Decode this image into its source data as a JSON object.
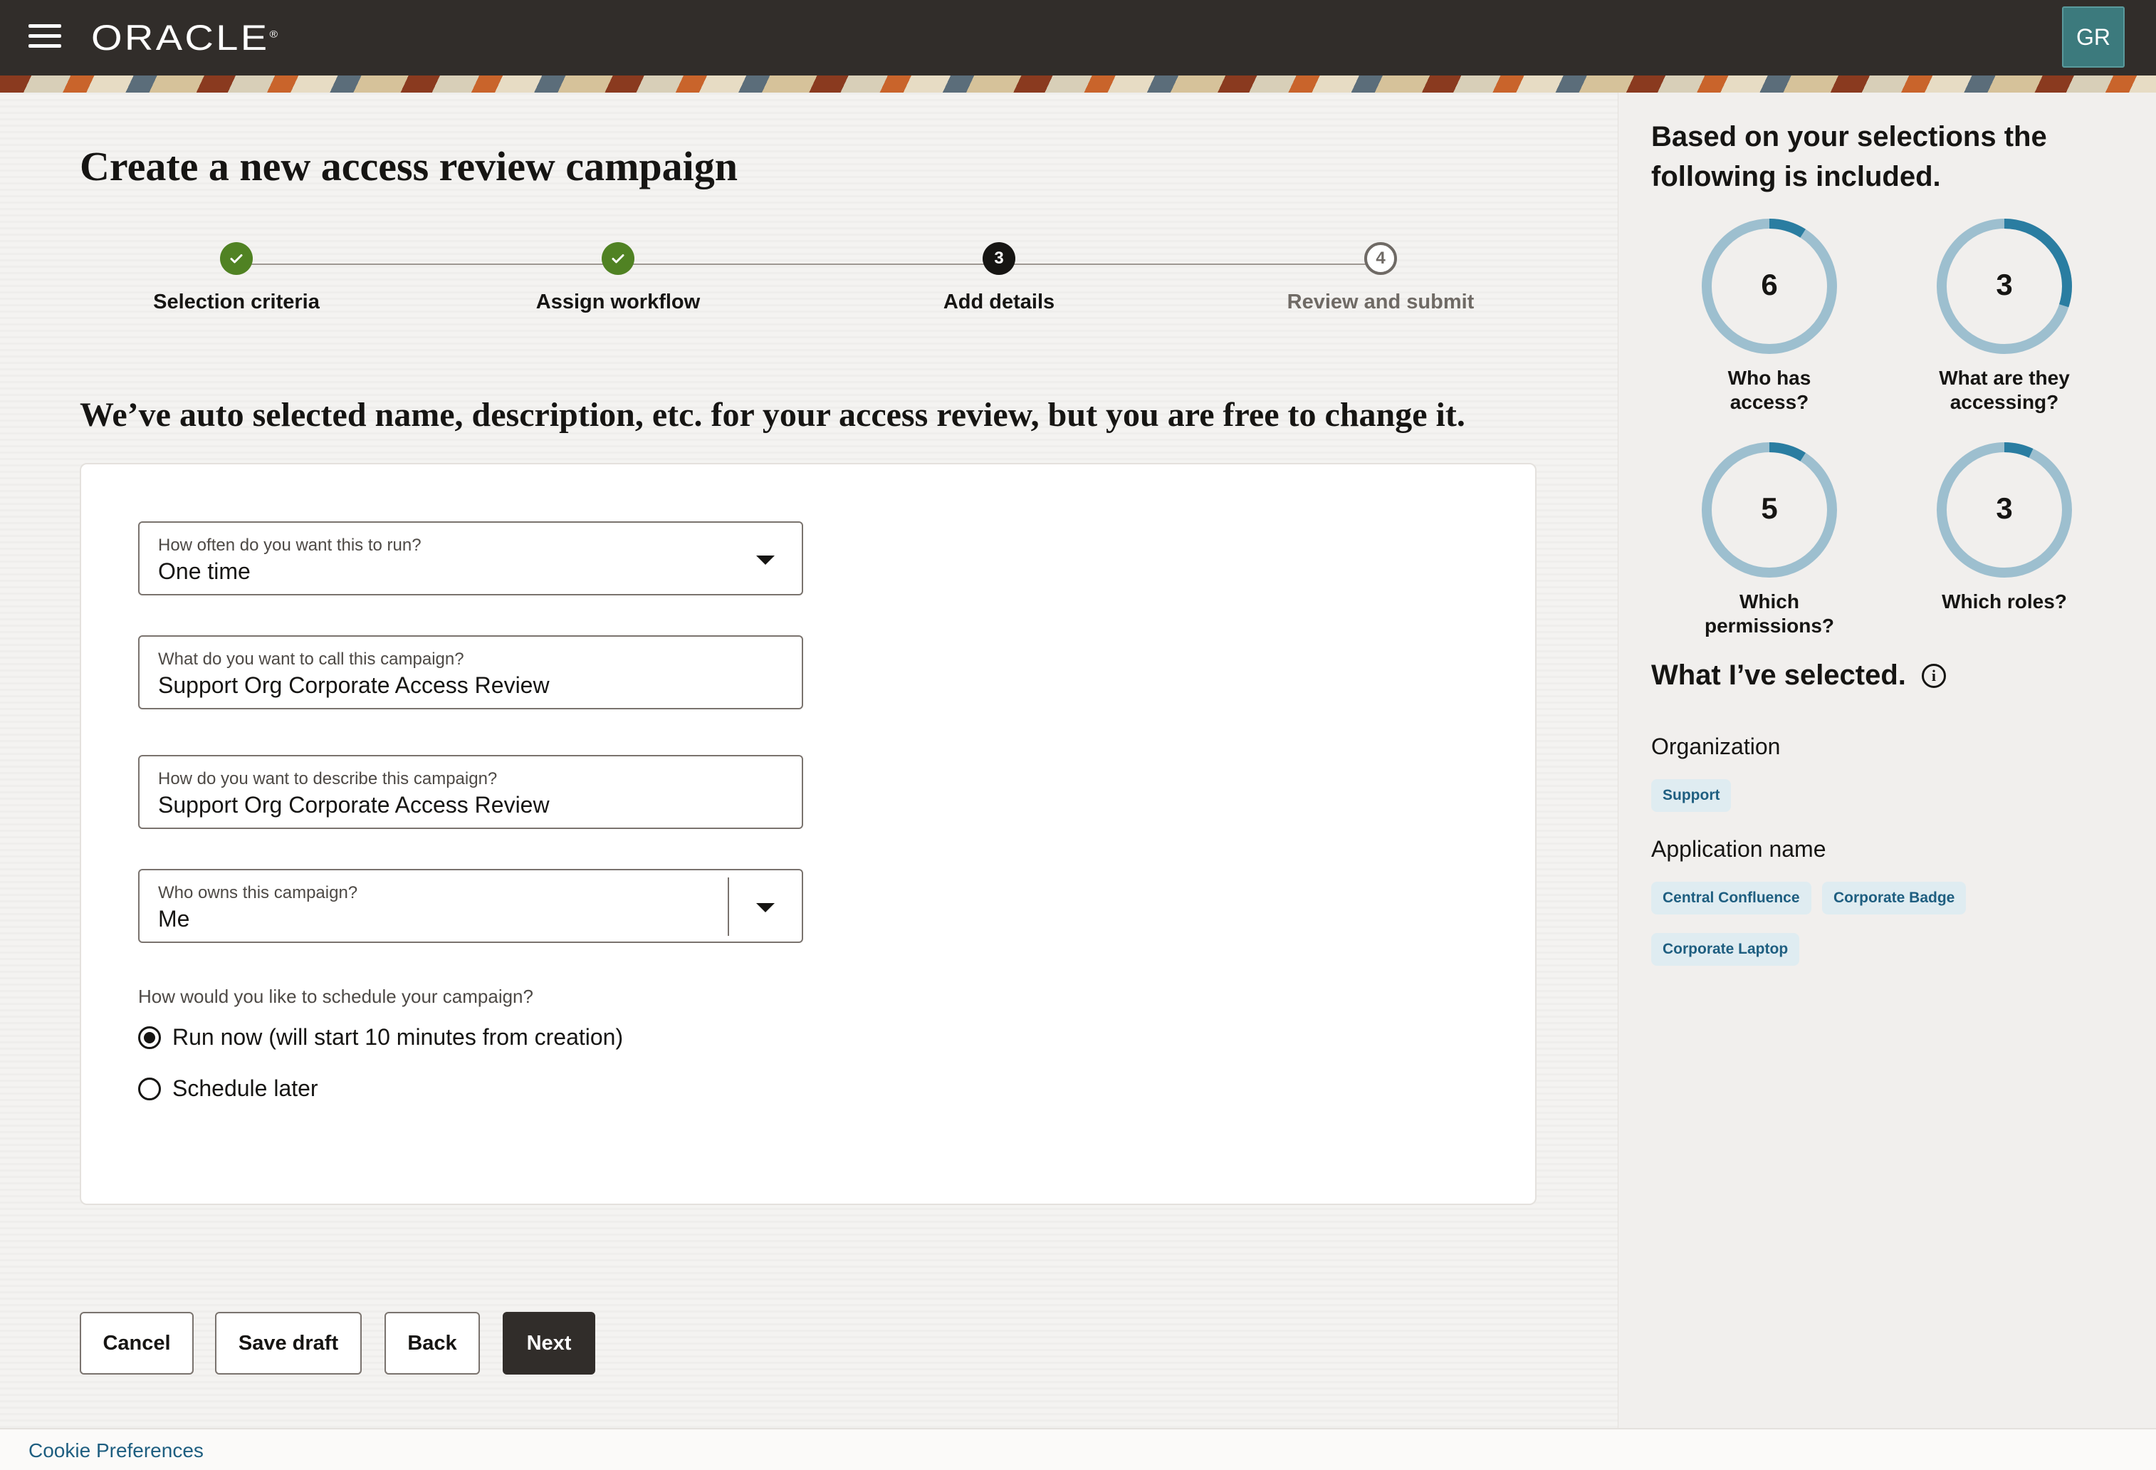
{
  "header": {
    "brand": "ORACLE",
    "brand_mark": "®",
    "avatar_initials": "GR"
  },
  "page": {
    "title": "Create a new access review campaign",
    "subtitle": "We’ve auto selected name, description, etc. for your access review, but you are free to change it."
  },
  "stepper": {
    "steps": [
      {
        "label": "Selection criteria",
        "state": "done",
        "marker": ""
      },
      {
        "label": "Assign workflow",
        "state": "done",
        "marker": ""
      },
      {
        "label": "Add details",
        "state": "current",
        "marker": "3"
      },
      {
        "label": "Review and submit",
        "state": "todo",
        "marker": "4"
      }
    ]
  },
  "form": {
    "frequency": {
      "label": "How often do you want this to run?",
      "value": "One time"
    },
    "name": {
      "label": "What do you want to call this campaign?",
      "value": "Support Org Corporate Access Review"
    },
    "description": {
      "label": "How do you want to describe this campaign?",
      "value": "Support Org Corporate Access Review"
    },
    "owner": {
      "label": "Who owns this campaign?",
      "value": "Me"
    },
    "schedule": {
      "label": "How would you like to schedule your campaign?",
      "options": [
        {
          "label": "Run now (will start 10 minutes from creation)",
          "selected": true
        },
        {
          "label": "Schedule later",
          "selected": false
        }
      ]
    }
  },
  "actions": {
    "cancel": "Cancel",
    "save_draft": "Save draft",
    "back": "Back",
    "next": "Next"
  },
  "summary": {
    "title": "Based on your selections the following is included.",
    "stats": [
      {
        "value": "6",
        "label": "Who has access?",
        "fraction": 0.09
      },
      {
        "value": "3",
        "label": "What are they accessing?",
        "fraction": 0.3
      },
      {
        "value": "5",
        "label": "Which permissions?",
        "fraction": 0.09
      },
      {
        "value": "3",
        "label": "Which roles?",
        "fraction": 0.07
      }
    ],
    "colors": {
      "track": "#9dbfcf",
      "fill": "#2a7da1"
    }
  },
  "selected": {
    "title": "What I’ve selected.",
    "organization_label": "Organization",
    "organizations": [
      "Support"
    ],
    "application_label": "Application name",
    "applications": [
      "Central Confluence",
      "Corporate Badge",
      "Corporate Laptop"
    ]
  },
  "footer": {
    "cookie": "Cookie Preferences"
  }
}
